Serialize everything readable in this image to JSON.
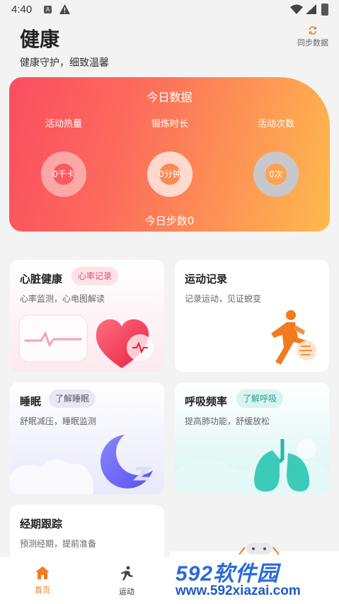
{
  "status_bar": {
    "time": "4:40",
    "notification_badge": "A"
  },
  "header": {
    "title": "健康",
    "subtitle": "健康守护，细致温馨",
    "sync_label": "同步数据"
  },
  "today": {
    "title": "今日数据",
    "items": [
      {
        "label": "活动热量",
        "value": "0千卡"
      },
      {
        "label": "锻炼时长",
        "value": "0分钟"
      },
      {
        "label": "活动次数",
        "value": "0次"
      }
    ],
    "steps": "今日步数0"
  },
  "cards": {
    "heart": {
      "title": "心脏健康",
      "tag": "心率记录",
      "desc": "心率监测，心电图解读"
    },
    "sport": {
      "title": "运动记录",
      "desc": "记录运动，见证蜕变"
    },
    "sleep": {
      "title": "睡眠",
      "tag": "了解睡眠",
      "desc": "舒眠减压，睡眠监测"
    },
    "breath": {
      "title": "呼吸频率",
      "tag": "了解呼吸",
      "desc": "提高肺功能，舒缓放松"
    },
    "period": {
      "title": "经期跟踪",
      "desc": "预测经期，提前准备"
    }
  },
  "bottom_nav": {
    "home": {
      "label": "首页",
      "active": true
    },
    "sport": {
      "label": "运动",
      "active": false
    }
  },
  "watermark": {
    "brand": "592软件园",
    "url": "www.592xiazai.com"
  },
  "colors": {
    "accent": "#f07c1e",
    "gradient_start": "#fb4d60",
    "gradient_end": "#ffba4d"
  }
}
